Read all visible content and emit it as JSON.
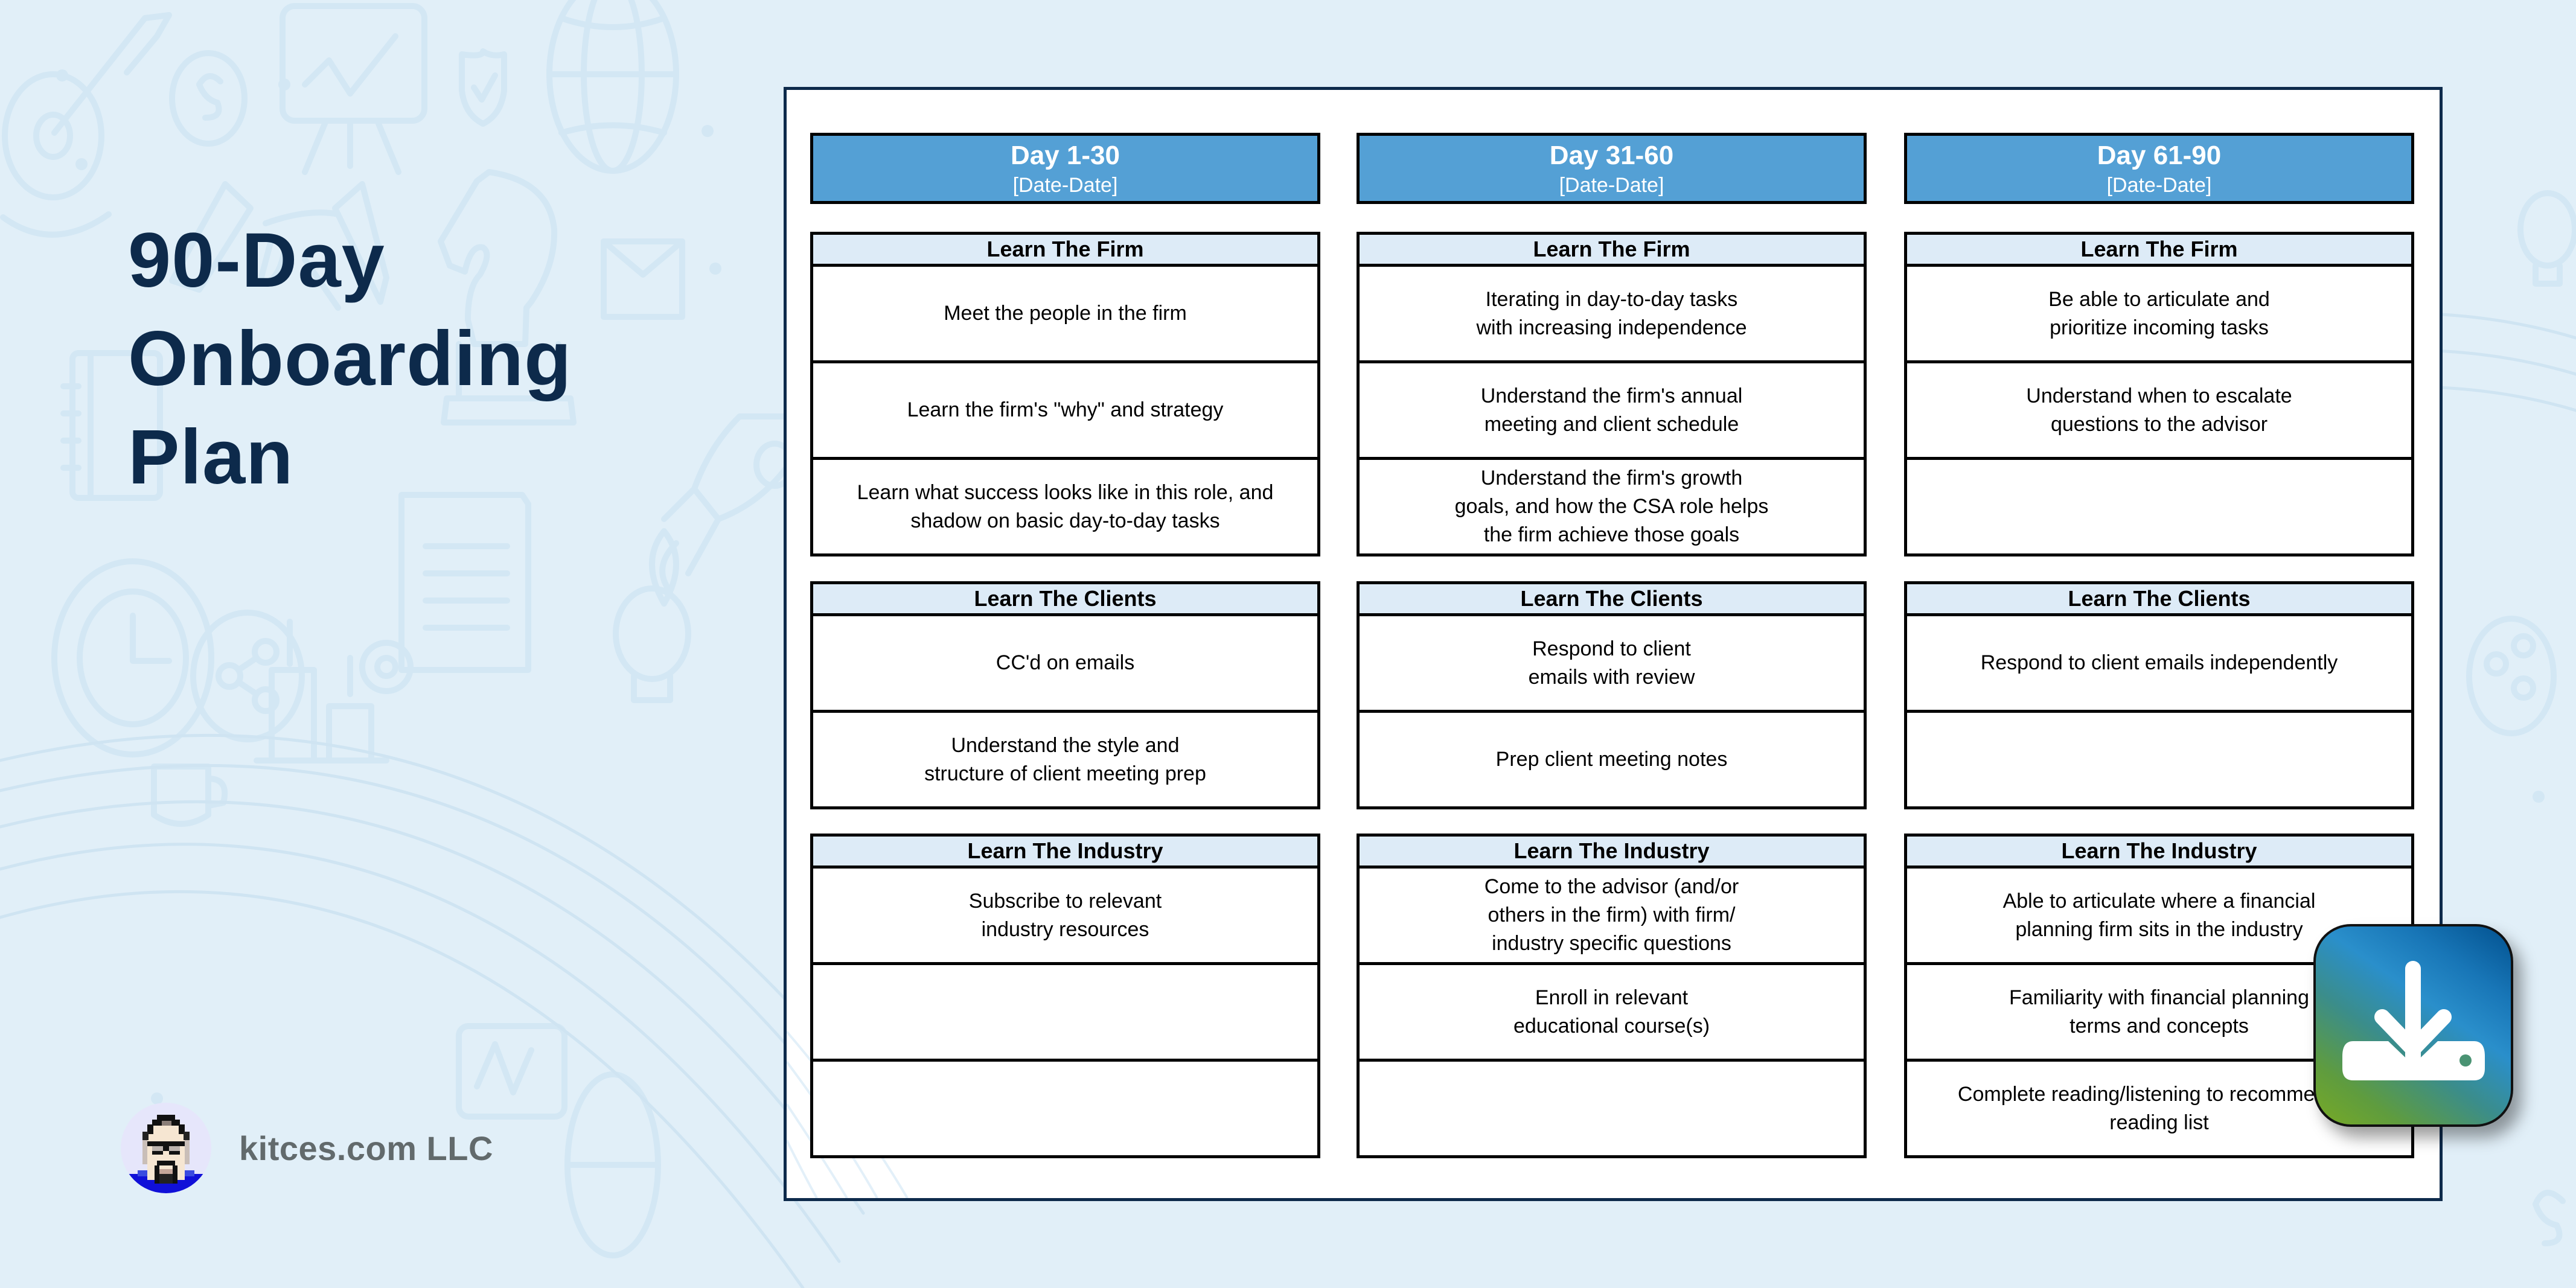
{
  "document": {
    "title_lines": [
      "90-Day",
      "Onboarding",
      "Plan"
    ],
    "brand": {
      "name": "kitces.com LLC",
      "avatar": "pixel-avatar"
    }
  },
  "periods": [
    {
      "title": "Day 1-30",
      "dates": "[Date-Date]",
      "sections": [
        {
          "header": "Learn The Firm",
          "tasks": [
            "Meet the people in the firm",
            "Learn the firm's \"why\" and strategy",
            "Learn what success looks like in this role, and\nshadow on basic day-to-day tasks"
          ]
        },
        {
          "header": "Learn The Clients",
          "tasks": [
            "CC'd on emails",
            "Understand the style and\nstructure of client meeting prep"
          ]
        },
        {
          "header": "Learn The Industry",
          "tasks": [
            "Subscribe to relevant\nindustry resources",
            "",
            ""
          ]
        }
      ]
    },
    {
      "title": "Day 31-60",
      "dates": "[Date-Date]",
      "sections": [
        {
          "header": "Learn The Firm",
          "tasks": [
            "Iterating in day-to-day tasks\nwith increasing independence",
            "Understand the firm's annual\nmeeting and client schedule",
            "Understand the firm's growth\ngoals, and how the CSA role helps\nthe firm achieve those goals"
          ]
        },
        {
          "header": "Learn The Clients",
          "tasks": [
            "Respond to client\nemails with review",
            "Prep client meeting notes"
          ]
        },
        {
          "header": "Learn The Industry",
          "tasks": [
            "Come to the advisor (and/or\nothers in the firm) with firm/\nindustry specific questions",
            "Enroll in relevant\neducational course(s)",
            ""
          ]
        }
      ]
    },
    {
      "title": "Day 61-90",
      "dates": "[Date-Date]",
      "sections": [
        {
          "header": "Learn The Firm",
          "tasks": [
            "Be able to articulate and\nprioritize incoming tasks",
            "Understand when to escalate\nquestions to the advisor",
            ""
          ]
        },
        {
          "header": "Learn The Clients",
          "tasks": [
            "Respond to client emails independently",
            ""
          ]
        },
        {
          "header": "Learn The Industry",
          "tasks": [
            "Able to articulate where a financial\nplanning firm sits in the industry",
            "Familiarity with financial planning\nterms and concepts",
            "Complete reading/listening to recommended\nreading list"
          ]
        }
      ]
    }
  ],
  "download_button": {
    "icon": "download-icon",
    "label": "Download"
  },
  "colors": {
    "background": "#e1eff8",
    "title": "#0d2a4b",
    "period_header": "#54a0d5",
    "section_header": "#ddebf7",
    "brand_text": "#626a6c"
  }
}
